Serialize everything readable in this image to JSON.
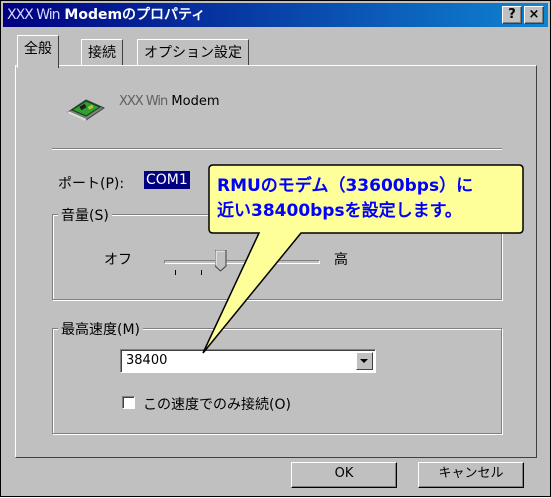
{
  "window": {
    "title_prefix": "XXX Win",
    "title": "Modemのプロパティ",
    "help_button": "?",
    "close_button": "×"
  },
  "tabs": [
    {
      "label": "全般"
    },
    {
      "label": "接続"
    },
    {
      "label": "オプション設定"
    }
  ],
  "device": {
    "name_prefix": "XXX Win",
    "name": "Modem"
  },
  "port": {
    "label": "ポート(P):",
    "value": "COM1"
  },
  "volume": {
    "label": "音量(S)",
    "min_label": "オフ",
    "max_label": "高",
    "level": 0.4
  },
  "speed": {
    "label": "最高速度(M)",
    "selected": "38400",
    "only_this_speed_label": "この速度でのみ接続(O)",
    "only_this_speed_checked": false
  },
  "callout": {
    "line1": "RMUのモデム（33600bps）に",
    "line2": "近い38400bpsを設定します。"
  },
  "buttons": {
    "ok": "OK",
    "cancel": "キャンセル"
  },
  "colors": {
    "titlebar_start": "#000080",
    "titlebar_end": "#1084d0",
    "callout_fill": "#ffff99",
    "callout_text": "#0000ff",
    "dialog_face": "#c0c0c0"
  }
}
